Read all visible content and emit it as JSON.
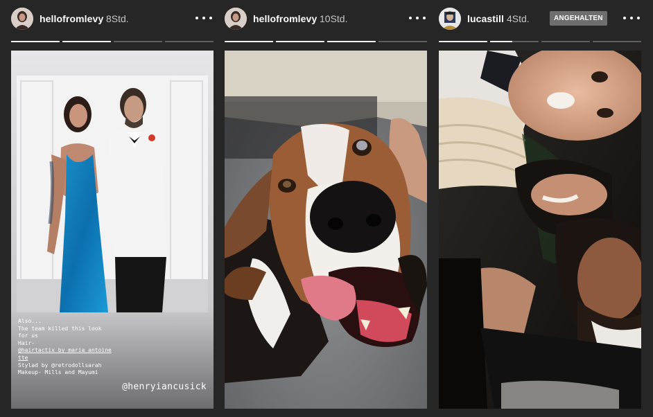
{
  "stories": [
    {
      "username": "hellofromlevy",
      "time": "8Std.",
      "avatar_icon": "profile-photo-woman",
      "progress": [
        1.0,
        1.0,
        0.0,
        0.0
      ],
      "caption": {
        "line1": "Also...",
        "line2": "The team killed this look",
        "line3": "for us",
        "line4": "Hair-",
        "line5": "@hairtactix_by_maria_antoine",
        "line6": "tte",
        "line7": "Stylad by @retrodollsarah",
        "line8": "Makeup- Mills and Mayumi"
      },
      "mention": "@henryiancusick"
    },
    {
      "username": "hellofromlevy",
      "time": "10Std.",
      "avatar_icon": "profile-photo-woman",
      "progress": [
        1.0,
        1.0,
        1.0,
        0.0
      ]
    },
    {
      "username": "lucastill",
      "time": "4Std.",
      "status_badge": "ANGEHALTEN",
      "avatar_icon": "profile-photo-man",
      "progress": [
        1.0,
        0.45,
        0.0,
        0.0
      ]
    }
  ],
  "colors": {
    "background": "#262626",
    "progress_done": "#f2f2f2",
    "progress_pending": "#5e5e5e",
    "badge": "#6e6e6e"
  },
  "icons": {
    "more": "more-options-icon"
  }
}
